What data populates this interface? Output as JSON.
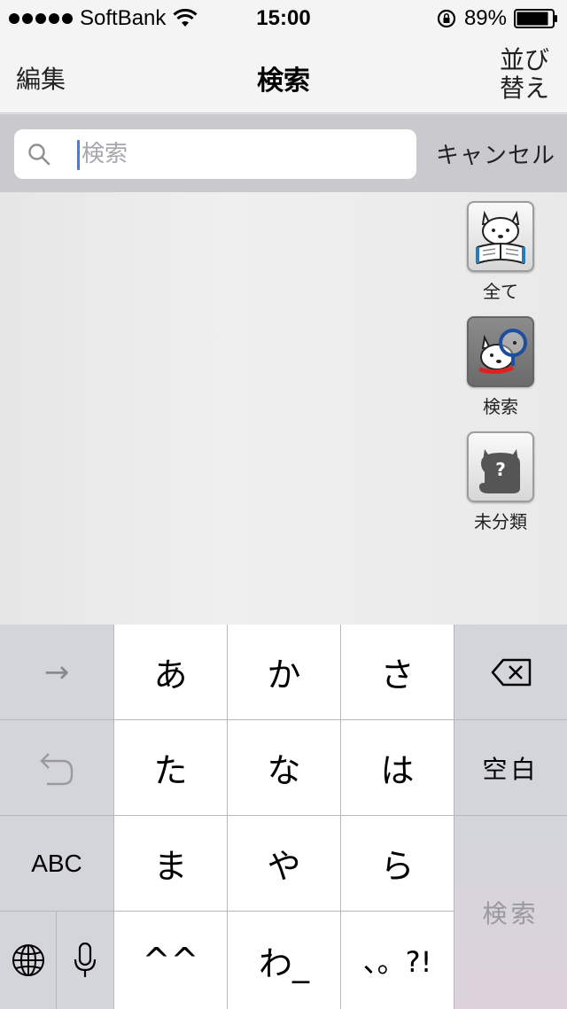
{
  "status_bar": {
    "carrier": "SoftBank",
    "time": "15:00",
    "battery_percent": "89%",
    "battery_level": 0.89
  },
  "nav": {
    "left_label": "編集",
    "title": "検索",
    "right_label_line1": "並び",
    "right_label_line2": "替え"
  },
  "search": {
    "placeholder": "検索",
    "value": "",
    "cancel_label": "キャンセル"
  },
  "categories": [
    {
      "label": "全て"
    },
    {
      "label": "検索",
      "selected": true
    },
    {
      "label": "未分類"
    }
  ],
  "keyboard": {
    "arrow": "→",
    "abc": "ABC",
    "space": "空白",
    "search": "検索",
    "kana": {
      "a": "あ",
      "ka": "か",
      "sa": "さ",
      "ta": "た",
      "na": "な",
      "ha": "は",
      "ma": "ま",
      "ya": "や",
      "ra": "ら",
      "dakuten": "^^",
      "wa": "わ_",
      "punct": "、。?!"
    }
  }
}
